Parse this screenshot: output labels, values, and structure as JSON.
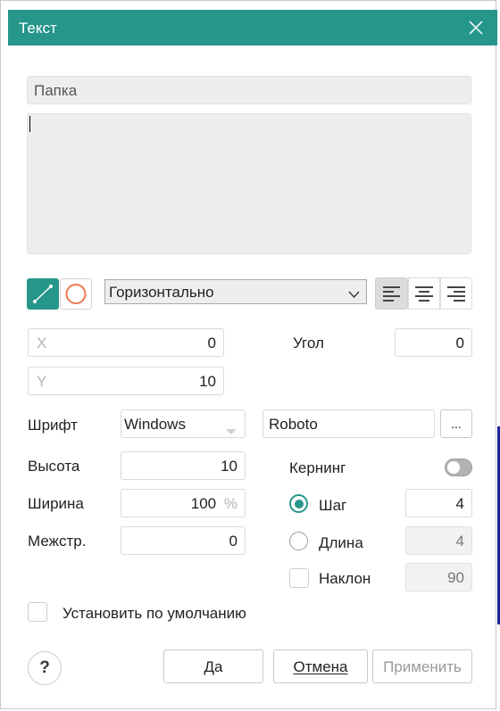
{
  "window": {
    "title": "Текст"
  },
  "text": {
    "folder_label": "Папка",
    "content": ""
  },
  "orientation": {
    "selected": "Горизонтально"
  },
  "position": {
    "x_placeholder": "X",
    "x_value": "0",
    "y_placeholder": "Y",
    "y_value": "10",
    "angle_label": "Угол",
    "angle_value": "0"
  },
  "font": {
    "label": "Шрифт",
    "type_value": "Windows",
    "name_value": "Roboto",
    "browse_label": "..."
  },
  "size": {
    "height_label": "Высота",
    "height_value": "10",
    "width_label": "Ширина",
    "width_value": "100",
    "width_unit": "%",
    "spacing_label": "Межстр.",
    "spacing_value": "0"
  },
  "kerning": {
    "label": "Кернинг",
    "enabled": false,
    "step_label": "Шаг",
    "step_value": "4",
    "step_selected": true,
    "length_label": "Длина",
    "length_value": "4",
    "slant_label": "Наклон",
    "slant_value": "90",
    "slant_checked": false
  },
  "defaults": {
    "label": "Установить по умолчанию",
    "checked": false
  },
  "buttons": {
    "help": "?",
    "ok": "Да",
    "cancel": "Отмена",
    "apply": "Применить"
  },
  "colors": {
    "accent": "#26968b",
    "circle_tool": "#f07850"
  }
}
